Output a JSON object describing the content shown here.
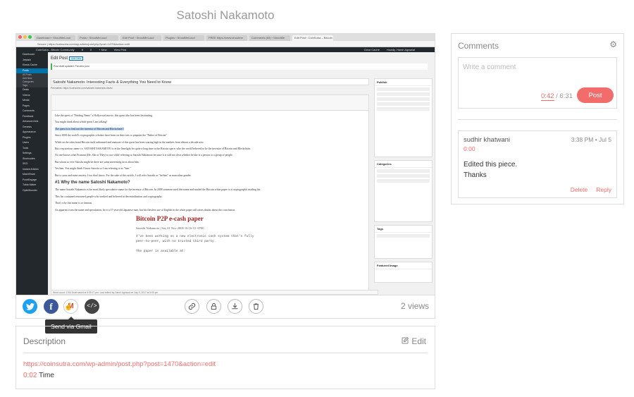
{
  "page": {
    "title": "Satoshi Nakamoto"
  },
  "screenshot": {
    "browser_tabs": [
      "Dashboard ‹ ShoutMeLoud",
      "Posts ‹ ShoutMeLoud",
      "Edit Post ‹ ShoutMeLoud",
      "Plugins ‹ ShoutMeLoud",
      "FREE https://www.shoutme",
      "Comments (60) ‹ ShoutMe",
      "Edit Post ‹ CoinSutra – Bitcoin"
    ],
    "url": "Secure | https://coinsutra.com/wp-admin/post.php?post=1470&action=edit",
    "adminbar": [
      "CoinSutra - Bitcoin Community",
      "8",
      "0",
      "+ New",
      "View Post",
      "Clear Cache",
      "Howdy, Harsh Agrawal"
    ],
    "sidebar": [
      "Dashboard",
      "Jetpack",
      "Kinsta Cache",
      "Posts",
      "All Posts",
      "Add New",
      "Categories",
      "Tags",
      "Deals",
      "Videos",
      "Media",
      "Pages",
      "Comments",
      "Feedback",
      "Advanced Ads",
      "Genesis",
      "Appearance",
      "Plugins",
      "Users",
      "Tools",
      "Settings",
      "Shortcodes",
      "SEO",
      "Instant Articles",
      "MashShare",
      "PushEngage",
      "Tubla Maker",
      "OptinMonster"
    ],
    "edit_heading": "Edit Post",
    "add_new": "Add New",
    "notice": "Post draft updated. Preview post",
    "post_title": "Satoshi Nakamoto: Interesting Facts & Everything You Need to Know",
    "permalink": "Permalink: https://coinsutra.com/satoshi-nakamoto-facts/",
    "editor_lines": [
      "Like the quest of \"Finding Nemo\" a Hollywood movie, this quest also has been fascinating.",
      "You might think about which quest I am talking?",
      "The quest is to find out the inventor of Bitcoin and Blockchain!!",
      "Since 2008 the world's cryptographic scholars have been on their toes to pinpoint the \"Father of Bitcoin\"",
      "While on the other hand Bitcoin itself unharmed and unaware of this quest has been soaring high in the markets from almost a decade now.",
      "But a mysterious name i.e. SATOSHI NAKAMOTO is in the limelight for quite a long time in the Bitcoin space, who the world believed to be the inventor of Bitcoin and Blockchain.",
      "No one knows what Pronoun (He, She or They) to use while referring to Satoshi Nakamoto because it is still not clear whether he/she is a person or a group of people.",
      "But whom so ever Satoshi might be there are some interesting facts about him.",
      "Yes him, You might think I know Satoshi so I am referring to as \"him.\"",
      "But to your and mine anxiety, I too don't know. For the sake of this article, I will refer Satoshi as \"he/him\" as masculine gender."
    ],
    "editor_heading": "#1 Why the name Satoshi Nakamoto?",
    "editor_lines_2": [
      "The name Satoshi Nakamoto is the most likely speculative name for the inventor of Bitcoin. In 2008 someone used this name and mailed the Bitcoin white paper to a cryptographic mailing list.",
      "This list contained renowned people who worked and believed in decentralization and cryptography.",
      "That's why this name is so famous.",
      "As apparent from the name and speculation, he is a 37-year-old Japanese man, but his flawless use of English in the white paper still raises doubts about this conclusion."
    ],
    "btc_title": "Bitcoin P2P e-cash paper",
    "btc_meta": "Satoshi Nakamoto  |  Sat, 01 Nov 2008 16:16:33 -0700",
    "btc_code": [
      "I've been working on a new electronic cash system that's fully",
      "peer-to-peer, with no trusted third party.",
      "",
      "The paper is available at:"
    ],
    "boxes": [
      "Publish",
      "Categories",
      "Tags",
      "Featured Image"
    ],
    "status_bar": "Word count: 1764          Draft saved at 5:05:17 pm. Last edited by Harsh Agrawal on July 5, 2017 at 5:05 pm"
  },
  "toolbar": {
    "views": "2 views",
    "tooltip": "Send via Gmail",
    "icons": {
      "twitter": "twitter-icon",
      "facebook": "facebook-icon",
      "gmail": "gmail-icon",
      "embed": "embed-icon",
      "link": "link-icon",
      "lock": "lock-icon",
      "download": "download-icon",
      "delete": "trash-icon"
    }
  },
  "description": {
    "title": "Description",
    "edit": "Edit",
    "url": "https://coinsutra.com/wp-admin/post.php?post=1470&action=edit",
    "timestamp": "0:02",
    "text": " Time"
  },
  "comments": {
    "title": "Comments",
    "placeholder": "Write a comment",
    "time_current": "0:42",
    "time_total": " / 6:31",
    "post_label": "Post",
    "items": [
      {
        "user": "sudhir khatwani",
        "date": "3:38 PM • Jul 5",
        "timestamp": "0:00",
        "lines": [
          "Edited this piece.",
          "Thanks"
        ],
        "delete": "Delete",
        "reply": "Reply"
      }
    ]
  },
  "colors": {
    "accent": "#f26c6c",
    "twitter": "#1da1f2",
    "facebook": "#3b5998",
    "gmail": "#d44638",
    "wp_dark": "#23282d",
    "wp_blue": "#0073aa"
  }
}
